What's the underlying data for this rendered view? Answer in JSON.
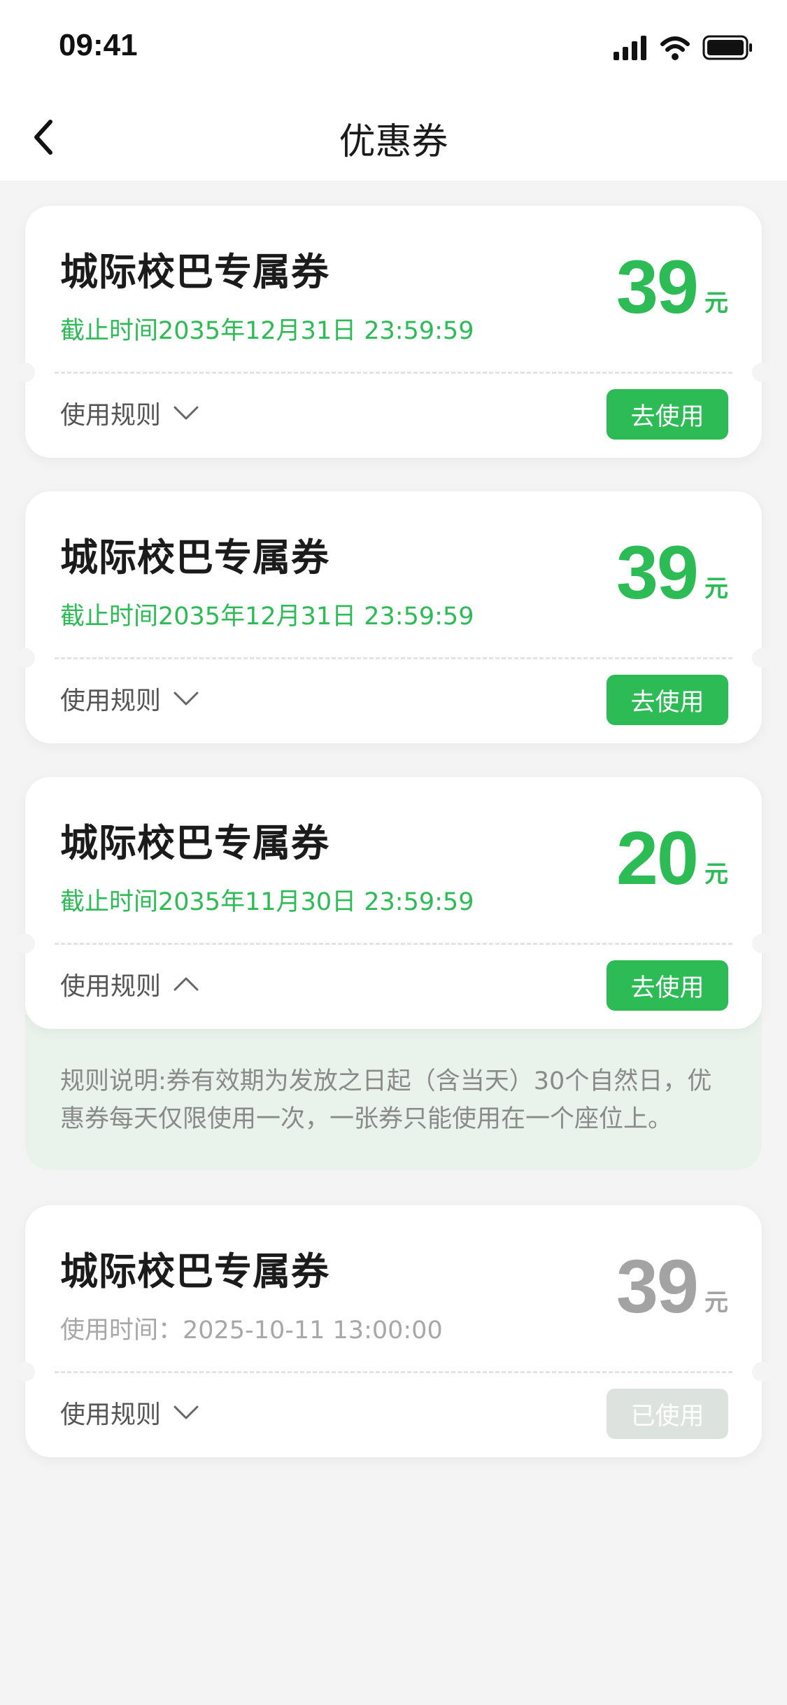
{
  "status": {
    "time": "09:41"
  },
  "nav": {
    "title": "优惠券"
  },
  "coupons": [
    {
      "title": "城际校巴专属券",
      "deadline": "截止时间2035年12月31日  23:59:59",
      "amount": "39",
      "unit": "元",
      "rules_label": "使用规则",
      "action": "去使用"
    },
    {
      "title": "城际校巴专属券",
      "deadline": "截止时间2035年12月31日  23:59:59",
      "amount": "39",
      "unit": "元",
      "rules_label": "使用规则",
      "action": "去使用"
    },
    {
      "title": "城际校巴专属券",
      "deadline": "截止时间2035年11月30日  23:59:59",
      "amount": "20",
      "unit": "元",
      "rules_label": "使用规则",
      "action": "去使用",
      "rules_text": "规则说明:券有效期为发放之日起（含当天）30个自然日，优惠券每天仅限使用一次，一张券只能使用在一个座位上。"
    },
    {
      "title": "城际校巴专属券",
      "deadline": "使用时间：2025-10-11  13:00:00",
      "amount": "39",
      "unit": "元",
      "rules_label": "使用规则",
      "action": "已使用"
    }
  ],
  "colors": {
    "accent": "#2dbb55",
    "used_button": "#dce3de",
    "rule_panel_bg": "#e9f3ec",
    "page_bg": "#f4f4f4"
  },
  "icons": {
    "back": "chevron-left-icon",
    "collapsed": "chevron-down-icon",
    "expanded": "chevron-up-icon",
    "signal": "signal-icon",
    "wifi": "wifi-icon",
    "battery": "battery-icon"
  }
}
